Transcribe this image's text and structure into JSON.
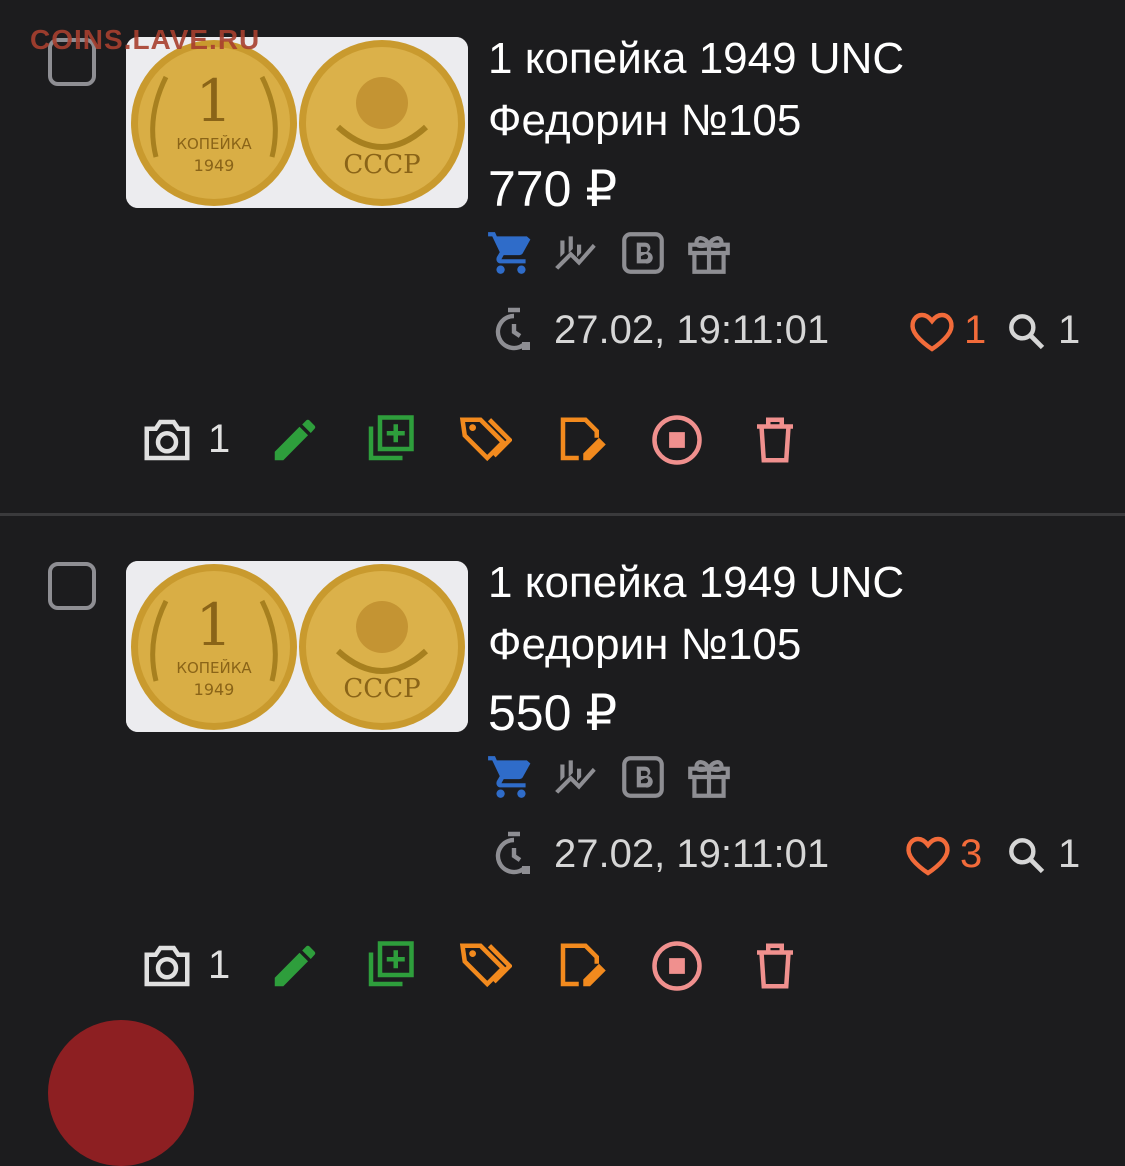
{
  "watermark": "COINS.LAVE.RU",
  "colors": {
    "background": "#1c1c1e",
    "cart": "#2f6cc9",
    "muted_icon": "#8e8e93",
    "like": "#f26b3a",
    "edit": "#2e9e3c",
    "tag": "#f28a1e",
    "stop": "#f0908e",
    "delete": "#f0908e"
  },
  "listings": [
    {
      "title": "1 копейка 1949 UNC\nФедорин №105",
      "price": "770 ₽",
      "timestamp": "27.02, 19:11:01",
      "likes": "1",
      "views": "1",
      "photo_count": "1",
      "icons": [
        "cart-icon",
        "chart-icon",
        "b-badge-icon",
        "gift-icon"
      ]
    },
    {
      "title": "1 копейка 1949 UNC\nФедорин №105",
      "price": "550 ₽",
      "timestamp": "27.02, 19:11:01",
      "likes": "3",
      "views": "1",
      "photo_count": "1",
      "icons": [
        "cart-icon",
        "chart-icon",
        "b-badge-icon",
        "gift-icon"
      ]
    }
  ],
  "actions": [
    "camera-icon",
    "edit-icon",
    "add-copy-icon",
    "tags-icon",
    "edit-note-icon",
    "stop-icon",
    "delete-icon"
  ],
  "coin_thumb": {
    "obverse": {
      "denomination": "1",
      "word": "КОПЕЙКА",
      "year": "1949"
    },
    "reverse": {
      "country": "СССР"
    }
  }
}
